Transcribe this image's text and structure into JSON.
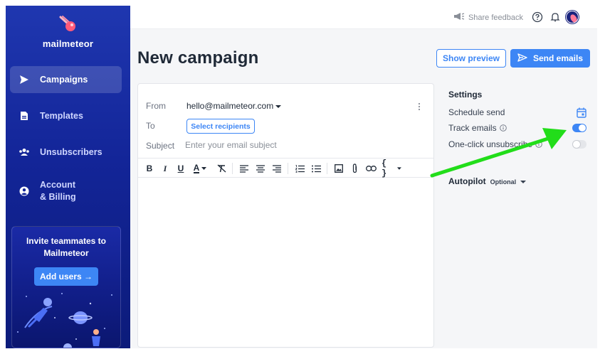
{
  "sidebar": {
    "brand": "mailmeteor",
    "items": [
      {
        "label": "Campaigns",
        "icon": "send-icon",
        "active": true
      },
      {
        "label": "Templates",
        "icon": "document-icon",
        "active": false
      },
      {
        "label": "Unsubscribers",
        "icon": "users-icon",
        "active": false
      },
      {
        "label": "Account",
        "label2": "& Billing",
        "icon": "account-icon",
        "active": false
      }
    ],
    "invite": {
      "title_line1": "Invite teammates to",
      "title_line2": "Mailmeteor",
      "button": "Add users →"
    }
  },
  "topbar": {
    "feedback": "Share feedback",
    "icons": [
      "megaphone-icon",
      "help-icon",
      "bell-icon",
      "avatar"
    ]
  },
  "header": {
    "title": "New campaign",
    "preview_button": "Show preview",
    "send_button": "Send emails"
  },
  "compose": {
    "from_label": "From",
    "from_value": "hello@mailmeteor.com",
    "to_label": "To",
    "recipients_button": "Select recipients",
    "subject_label": "Subject",
    "subject_placeholder": "Enter your email subject",
    "subject_value": "",
    "toolbar_icons": [
      "bold-icon",
      "italic-icon",
      "underline-icon",
      "text-color-icon",
      "clear-format-icon",
      "align-left-icon",
      "align-center-icon",
      "align-right-icon",
      "numbered-list-icon",
      "bulleted-list-icon",
      "image-icon",
      "attachment-icon",
      "link-icon",
      "variable-icon"
    ],
    "toolbar_glyphs": {
      "bold": "B",
      "italic": "I",
      "underline": "U",
      "color": "A",
      "variables": "{ }"
    }
  },
  "settings": {
    "title": "Settings",
    "schedule_label": "Schedule send",
    "track_label": "Track emails",
    "track_enabled": true,
    "unsubscribe_label": "One-click unsubscribe",
    "unsubscribe_enabled": false,
    "autopilot_label": "Autopilot",
    "autopilot_badge": "Optional"
  },
  "colors": {
    "accent": "#3d86f5",
    "sidebar": "#132598",
    "annotation_arrow": "#22dd1a"
  }
}
